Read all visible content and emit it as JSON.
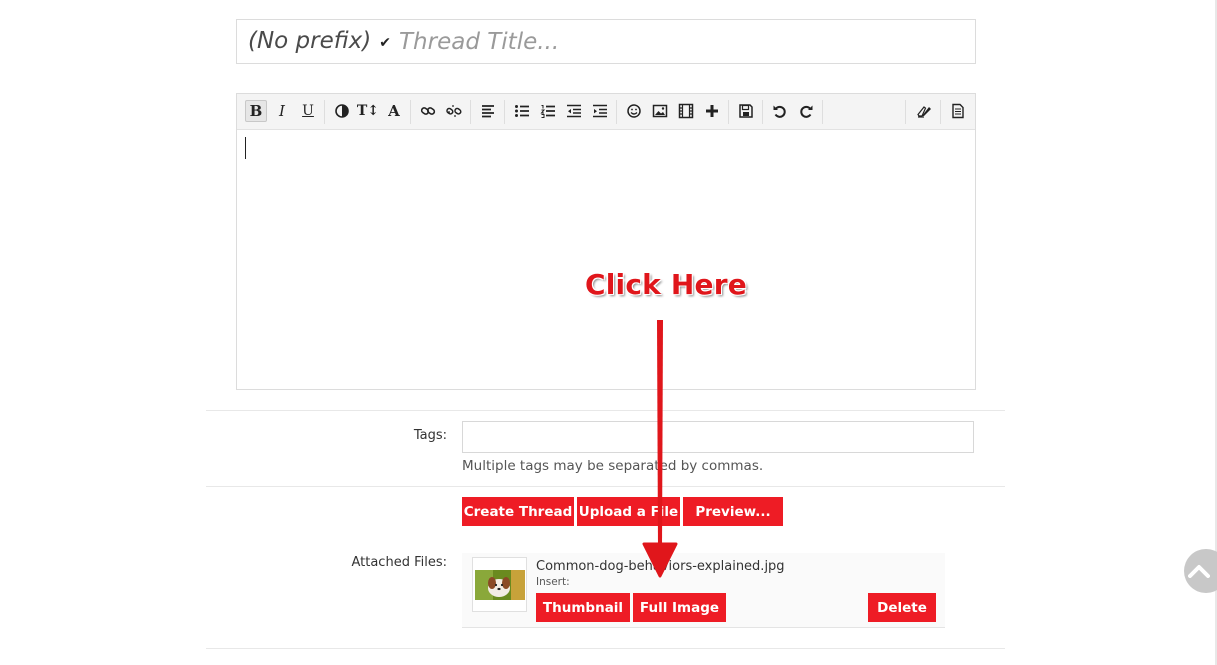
{
  "thread": {
    "prefix_label": "(No prefix)",
    "title_placeholder": "Thread Title..."
  },
  "toolbar": {
    "buttons": [
      "bold-icon",
      "italic-icon",
      "underline-icon",
      "color-icon",
      "font-size-icon",
      "font-family-icon",
      "link-icon",
      "unlink-icon",
      "align-icon",
      "bullet-list-icon",
      "numbered-list-icon",
      "outdent-icon",
      "indent-icon",
      "smilie-icon",
      "image-icon",
      "media-icon",
      "more-icon",
      "save-draft-icon",
      "undo-icon",
      "redo-icon",
      "remove-formatting-icon",
      "toggle-bbcode-icon"
    ],
    "bold": "B",
    "italic": "I",
    "underline": "U",
    "font_size": "T↕",
    "font_family": "A"
  },
  "annotation": {
    "text": "Click Here",
    "color": "#e0161b"
  },
  "tags": {
    "label": "Tags:",
    "hint": "Multiple tags may be separated by commas."
  },
  "actions": {
    "create": "Create Thread",
    "upload": "Upload a File",
    "preview": "Preview..."
  },
  "attachments": {
    "label": "Attached Files:",
    "filename": "Common-dog-behaviors-explained.jpg",
    "insert_label": "Insert:",
    "thumbnail_btn": "Thumbnail",
    "full_image_btn": "Full Image",
    "delete_btn": "Delete"
  },
  "colors": {
    "accent": "#ee1c25"
  }
}
